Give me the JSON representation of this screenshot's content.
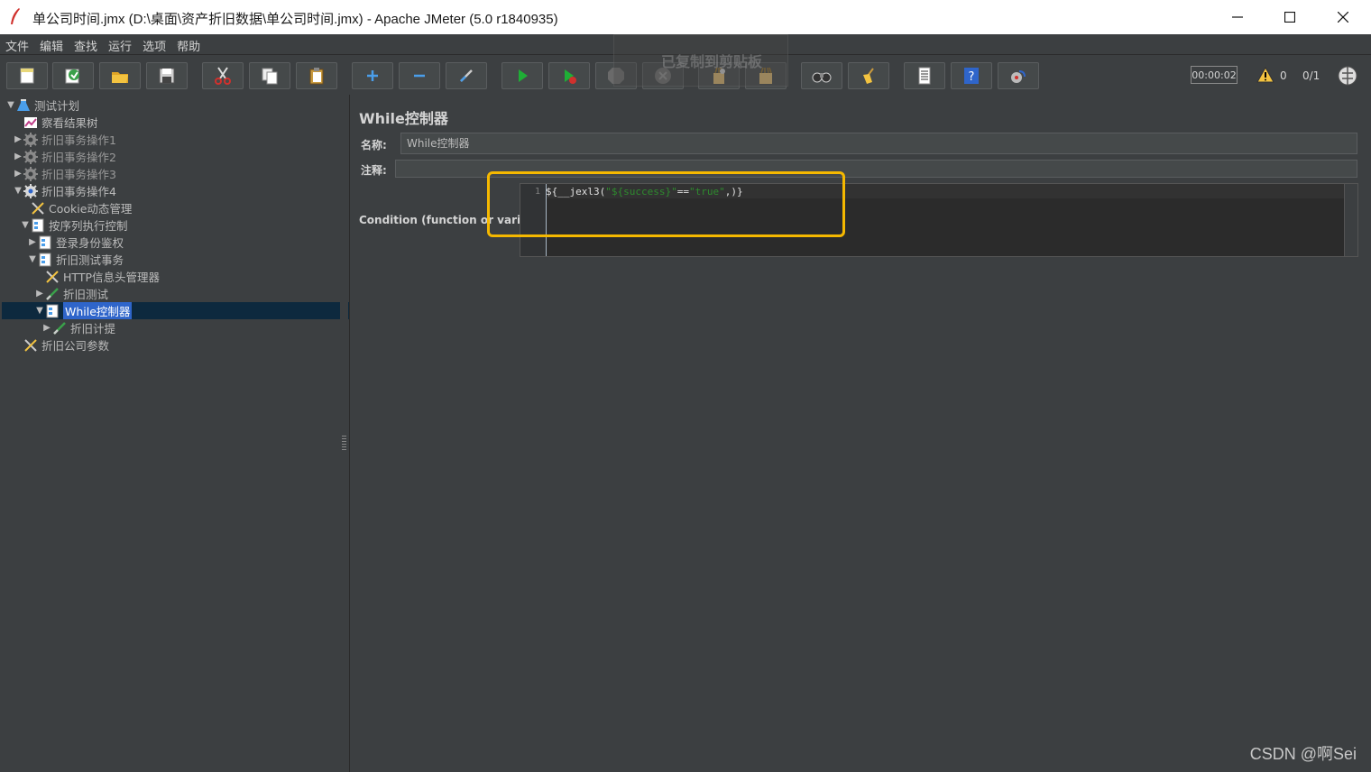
{
  "window": {
    "title": "单公司时间.jmx (D:\\桌面\\资产折旧数据\\单公司时间.jmx) - Apache JMeter (5.0 r1840935)",
    "buttons": [
      "minimize",
      "maximize",
      "close"
    ]
  },
  "menu": [
    "文件",
    "编辑",
    "查找",
    "运行",
    "选项",
    "帮助"
  ],
  "toast": "已复制到剪贴板",
  "toolbar": {
    "buttons": [
      {
        "name": "new-icon"
      },
      {
        "name": "templates-icon"
      },
      {
        "name": "open-icon"
      },
      {
        "name": "save-icon"
      },
      {
        "name": "cut-icon"
      },
      {
        "name": "copy-icon"
      },
      {
        "name": "paste-icon"
      },
      {
        "name": "expand-icon"
      },
      {
        "name": "collapse-icon"
      },
      {
        "name": "toggle-icon"
      },
      {
        "name": "start-icon"
      },
      {
        "name": "start-no-pause-icon"
      },
      {
        "name": "stop-icon"
      },
      {
        "name": "shutdown-icon"
      },
      {
        "name": "clear-icon"
      },
      {
        "name": "clear-all-icon"
      },
      {
        "name": "search-icon"
      },
      {
        "name": "reset-search-icon"
      },
      {
        "name": "function-helper-icon"
      },
      {
        "name": "help-icon"
      },
      {
        "name": "remote-icon"
      }
    ],
    "timer": "00:00:02",
    "warning_count": "0",
    "threads": "0/1"
  },
  "tree": [
    {
      "label": "测试计划",
      "icon": "test-plan-icon",
      "indent": 0,
      "expanded": true,
      "arrow": true
    },
    {
      "label": "察看结果树",
      "icon": "listener-icon",
      "indent": 1,
      "arrow": false
    },
    {
      "label": "折旧事务操作1",
      "icon": "thread-group-icon",
      "indent": 1,
      "arrow": true,
      "disabled": true
    },
    {
      "label": "折旧事务操作2",
      "icon": "thread-group-icon",
      "indent": 1,
      "arrow": true,
      "disabled": true
    },
    {
      "label": "折旧事务操作3",
      "icon": "thread-group-icon",
      "indent": 1,
      "arrow": true,
      "disabled": true
    },
    {
      "label": "折旧事务操作4",
      "icon": "thread-group-icon",
      "indent": 1,
      "expanded": true,
      "arrow": true
    },
    {
      "label": "Cookie动态管理",
      "icon": "config-icon",
      "indent": 2,
      "arrow": false
    },
    {
      "label": "按序列执行控制",
      "icon": "controller-icon",
      "indent": 2,
      "expanded": true,
      "arrow": true
    },
    {
      "label": "登录身份鉴权",
      "icon": "controller-icon",
      "indent": 3,
      "arrow": true
    },
    {
      "label": "折旧测试事务",
      "icon": "controller-icon",
      "indent": 3,
      "expanded": true,
      "arrow": true
    },
    {
      "label": "HTTP信息头管理器",
      "icon": "config-icon",
      "indent": 4,
      "arrow": false
    },
    {
      "label": "折旧测试",
      "icon": "sampler-icon",
      "indent": 4,
      "arrow": true
    },
    {
      "label": "While控制器",
      "icon": "controller-icon",
      "indent": 4,
      "expanded": true,
      "arrow": true,
      "selected": true
    },
    {
      "label": "折旧计提",
      "icon": "sampler-icon",
      "indent": 5,
      "arrow": true
    },
    {
      "label": "折旧公司参数",
      "icon": "config-icon",
      "indent": 1,
      "arrow": false
    }
  ],
  "panel": {
    "title": "While控制器",
    "name_label": "名称:",
    "name_value": "While控制器",
    "comment_label": "注释:",
    "comment_value": "",
    "condition_label": "Condition (function or variable)",
    "editor": {
      "line_number": "1",
      "code_prefix": "${__jexl3(",
      "code_str1": "\"${success}\"",
      "code_op": "==",
      "code_str2": "\"true\"",
      "code_suffix": ",)}"
    }
  },
  "watermark": "CSDN @啊Sei",
  "colors": {
    "highlight": "#f5b800",
    "selection": "#2f65ca",
    "background": "#3c3f41"
  }
}
